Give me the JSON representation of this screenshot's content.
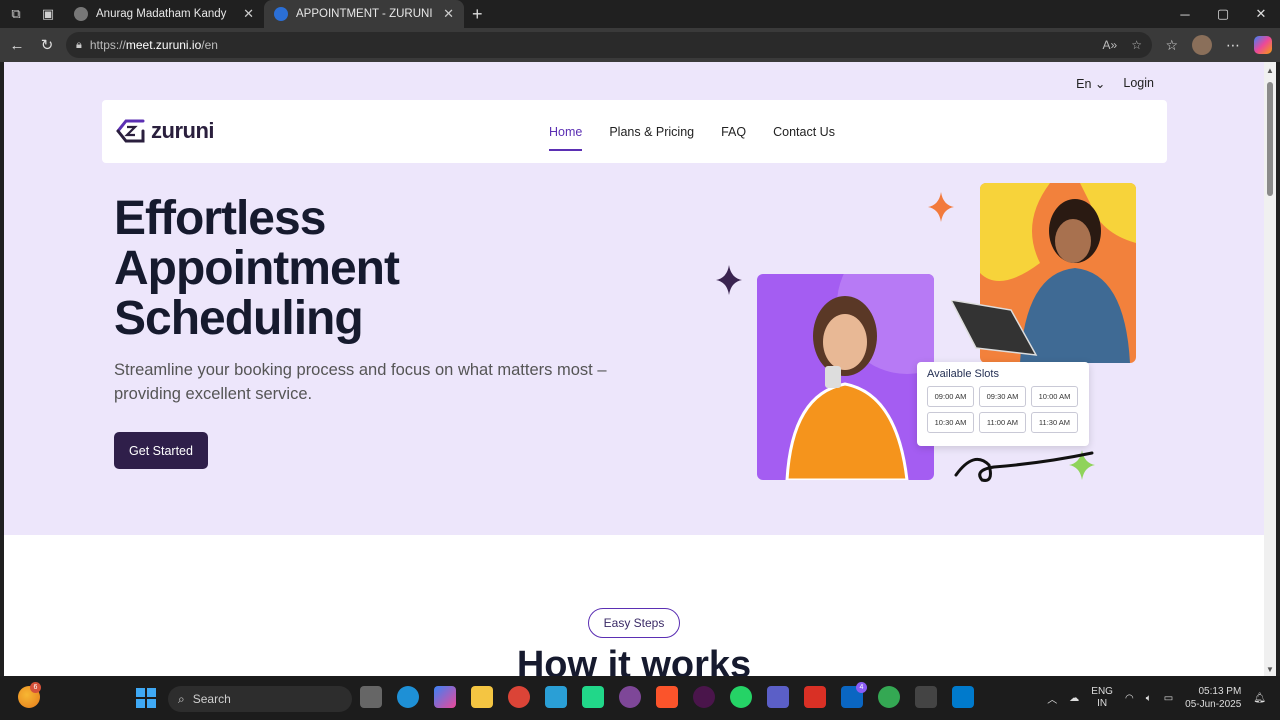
{
  "browser": {
    "tabs": [
      {
        "title": "Anurag Madatham Kandy",
        "active": false
      },
      {
        "title": "APPOINTMENT - ZURUNI",
        "active": true
      }
    ],
    "url_prefix": "https://",
    "url_host": "meet.zuruni.io",
    "url_path": "/en"
  },
  "site": {
    "lang_label": "En",
    "login_label": "Login",
    "logo_text": "zuruni",
    "menu": [
      "Home",
      "Plans & Pricing",
      "FAQ",
      "Contact Us"
    ],
    "active_menu": "Home",
    "headline_lines": [
      "Effortless",
      "Appointment",
      "Scheduling"
    ],
    "subtitle": "Streamline your booking process and focus on what matters most – providing excellent service.",
    "cta_label": "Get Started",
    "slots_title": "Available Slots",
    "slots": [
      "09:00 AM",
      "09:30 AM",
      "10:00 AM",
      "10:30 AM",
      "11:00 AM",
      "11:30 AM"
    ],
    "easy_steps_label": "Easy Steps",
    "how_title": "How it works"
  },
  "colors": {
    "hero_bg": "#ede6fb",
    "accent": "#5b2fb3",
    "cta_bg": "#2f1f4a",
    "headline": "#161a2e"
  },
  "taskbar": {
    "search_placeholder": "Search",
    "notif_count": "6",
    "linkedin_badge": "4",
    "lang_line1": "ENG",
    "lang_line2": "IN",
    "time": "05:13 PM",
    "date": "05-Jun-2025"
  }
}
